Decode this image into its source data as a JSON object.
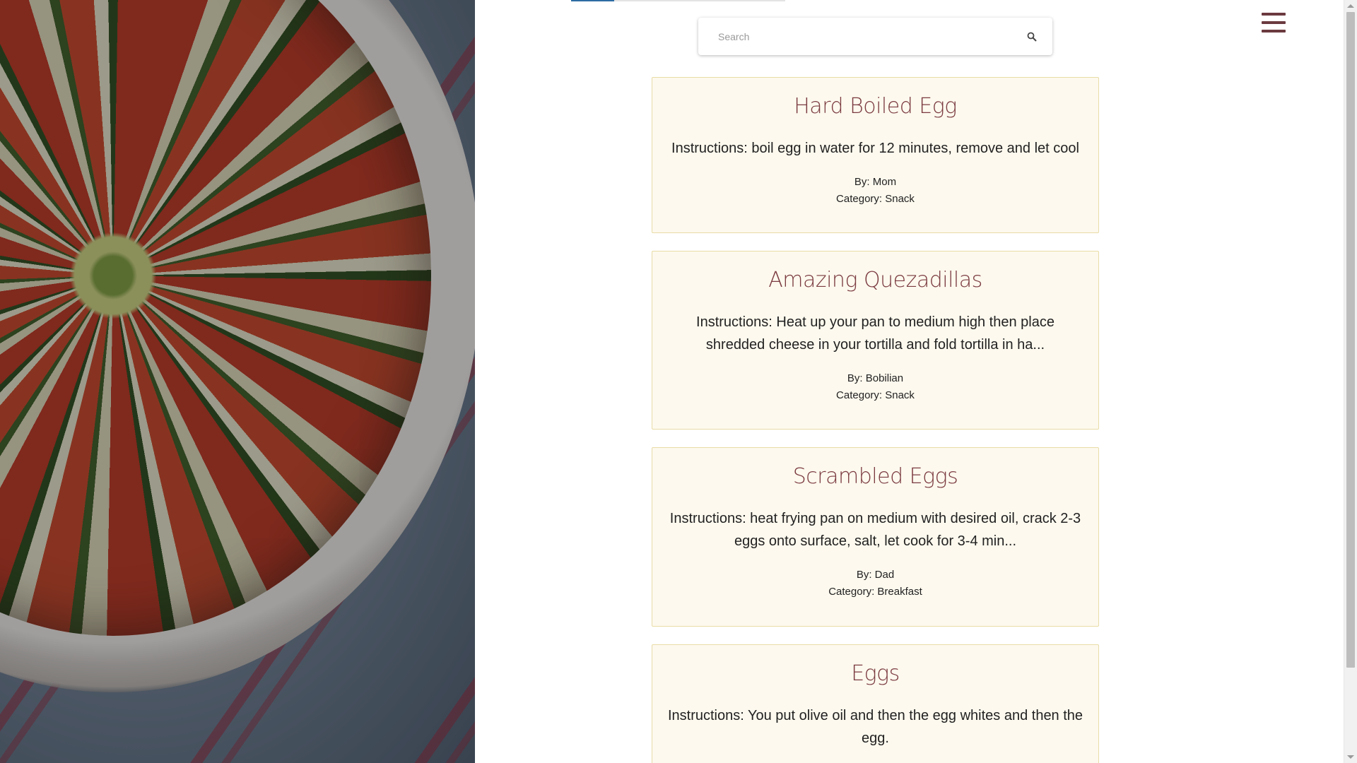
{
  "search": {
    "placeholder": "Search",
    "icon": "search-icon"
  },
  "menu": {
    "icon": "hamburger-menu-icon",
    "color": "#6b3a3f"
  },
  "progress": {
    "value_percent": 20,
    "color": "#2d6da3"
  },
  "colors": {
    "card_bg": "#fdf9ee",
    "card_border": "#e9dca6",
    "title": "#7b3b40"
  },
  "recipes": [
    {
      "title": "Hard Boiled Egg",
      "instructions": "Instructions: boil egg in water for 12 minutes, remove and let cool",
      "by": "By: Mom",
      "category": "Category: Snack"
    },
    {
      "title": "Amazing Quezadillas",
      "instructions": "Instructions: Heat up your pan to medium high then place shredded cheese in your tortilla and fold tortilla in ha...",
      "by": "By: Bobilian",
      "category": "Category: Snack"
    },
    {
      "title": "Scrambled Eggs",
      "instructions": "Instructions: heat frying pan on medium with desired oil, crack 2-3 eggs onto surface, salt, let cook for 3-4 min...",
      "by": "By: Dad",
      "category": "Category: Breakfast"
    },
    {
      "title": "Eggs",
      "instructions": "Instructions: You put olive oil and then the egg whites and then the egg.",
      "by": "",
      "category": ""
    }
  ]
}
